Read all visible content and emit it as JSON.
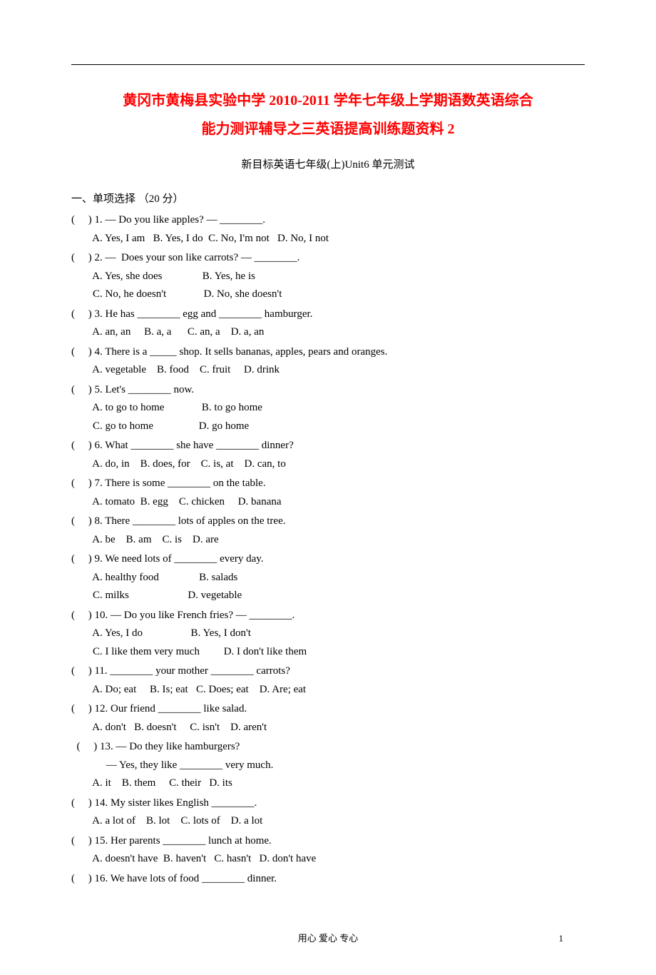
{
  "title_line1": "黄冈市黄梅县实验中学 2010-2011 学年七年级上学期语数英语综合",
  "title_line2": "能力测评辅导之三英语提高训练题资料 2",
  "subtitle": "新目标英语七年级(上)Unit6 单元测试",
  "section1_header": "一、单项选择   （20 分）",
  "questions": [
    {
      "stem": "(     ) 1. — Do you like apples? — ________.",
      "opts": [
        "  A. Yes, I am   B. Yes, I do  C. No, I'm not   D. No, I not"
      ]
    },
    {
      "stem": "(     ) 2. —  Does your son like carrots? — ________.",
      "opts": [
        "  A. Yes, she does               B. Yes, he is",
        "  C. No, he doesn't              D. No, she doesn't"
      ]
    },
    {
      "stem": "(     ) 3. He has ________ egg and ________ hamburger.",
      "opts": [
        "  A. an, an     B. a, a      C. an, a    D. a, an"
      ]
    },
    {
      "stem": "(     ) 4. There is a _____ shop. It sells bananas, apples, pears and oranges.",
      "opts": [
        "  A. vegetable    B. food    C. fruit     D. drink"
      ]
    },
    {
      "stem": "(     ) 5. Let's ________ now.",
      "opts": [
        "  A. to go to home              B. to go home",
        "  C. go to home                 D. go home"
      ]
    },
    {
      "stem": "(     ) 6. What ________ she have ________ dinner?",
      "opts": [
        "  A. do, in    B. does, for    C. is, at    D. can, to"
      ]
    },
    {
      "stem": "(     ) 7. There is some ________ on the table.",
      "opts": [
        "  A. tomato  B. egg    C. chicken     D. banana"
      ]
    },
    {
      "stem": "(     ) 8. There ________ lots of apples on the tree.",
      "opts": [
        "  A. be    B. am    C. is    D. are"
      ]
    },
    {
      "stem": "(     ) 9. We need lots of ________ every day.",
      "opts": [
        "  A. healthy food               B. salads",
        "  C. milks                      D. vegetable"
      ]
    },
    {
      "stem": "(     ) 10. — Do you like French fries? — ________.",
      "opts": [
        "  A. Yes, I do                  B. Yes, I don't",
        "  C. I like them very much         D. I don't like them"
      ]
    },
    {
      "stem": "(     ) 11. ________ your mother ________ carrots?",
      "opts": [
        "  A. Do; eat     B. Is; eat   C. Does; eat    D. Are; eat"
      ]
    },
    {
      "stem": "(     ) 12. Our friend ________ like salad.",
      "opts": [
        "  A. don't   B. doesn't     C. isn't    D. aren't"
      ]
    },
    {
      "stem": "  (     ) 13. — Do they like hamburgers?",
      "stem2": "             — Yes, they like ________ very much.",
      "opts": [
        "  A. it    B. them     C. their   D. its"
      ]
    },
    {
      "stem": "(     ) 14. My sister likes English ________.",
      "opts": [
        "  A. a lot of    B. lot    C. lots of    D. a lot"
      ]
    },
    {
      "stem": "(     ) 15. Her parents ________ lunch at home.",
      "opts": [
        "  A. doesn't have  B. haven't   C. hasn't   D. don't have"
      ]
    },
    {
      "stem": "(     ) 16. We have lots of food ________ dinner.",
      "opts": []
    }
  ],
  "footer_text": "用心   爱心   专心",
  "page_number": "1"
}
